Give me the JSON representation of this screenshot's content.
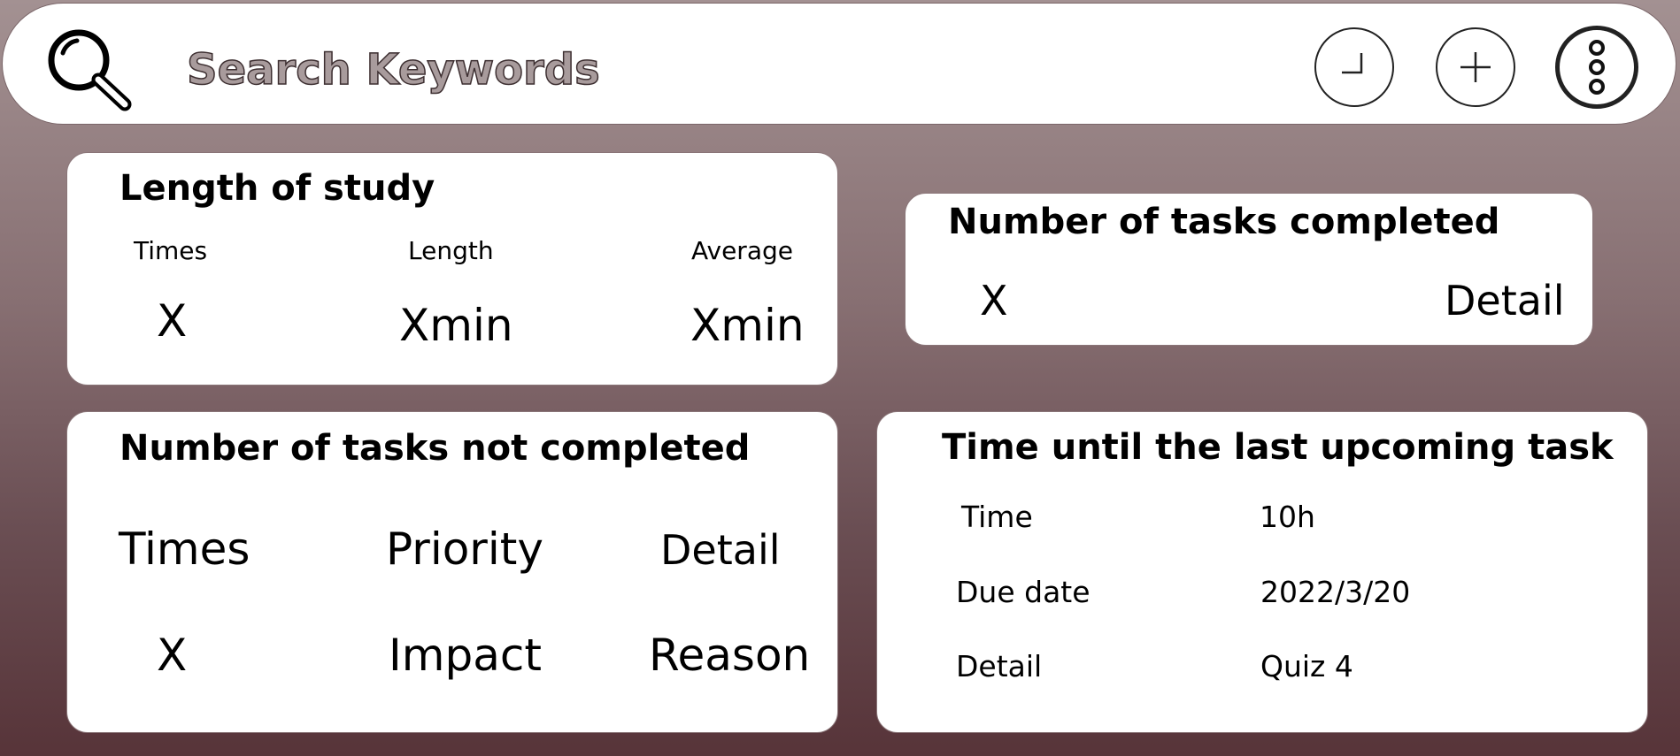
{
  "search": {
    "placeholder": "Search Keywords",
    "icon": "magnifier-icon"
  },
  "toolbar": {
    "clock_icon": "clock-icon",
    "add_icon": "plus-icon",
    "more_icon": "vertical-dots-icon"
  },
  "study": {
    "title": "Length of study",
    "columns": [
      {
        "label": "Times",
        "value": "X"
      },
      {
        "label": "Length",
        "value": "Xmin"
      },
      {
        "label": "Average",
        "value": "Xmin"
      }
    ]
  },
  "completed": {
    "title": "Number of tasks completed",
    "value": "X",
    "detail": "Detail"
  },
  "not_completed": {
    "title": "Number of tasks not completed",
    "headers": [
      "Times",
      "Priority",
      "Detail"
    ],
    "values": [
      "X",
      "Impact",
      "Reason"
    ]
  },
  "upcoming": {
    "title": "Time until the last upcoming task",
    "rows": [
      {
        "label": "Time",
        "value": "10h"
      },
      {
        "label": "Due date",
        "value": "2022/3/20"
      },
      {
        "label": "Detail",
        "value": "Quiz 4"
      }
    ]
  },
  "colors": {
    "background_top": "#a39192",
    "background_bottom": "#573439",
    "card": "#ffffff",
    "placeholder_fill": "#a89b9c"
  }
}
